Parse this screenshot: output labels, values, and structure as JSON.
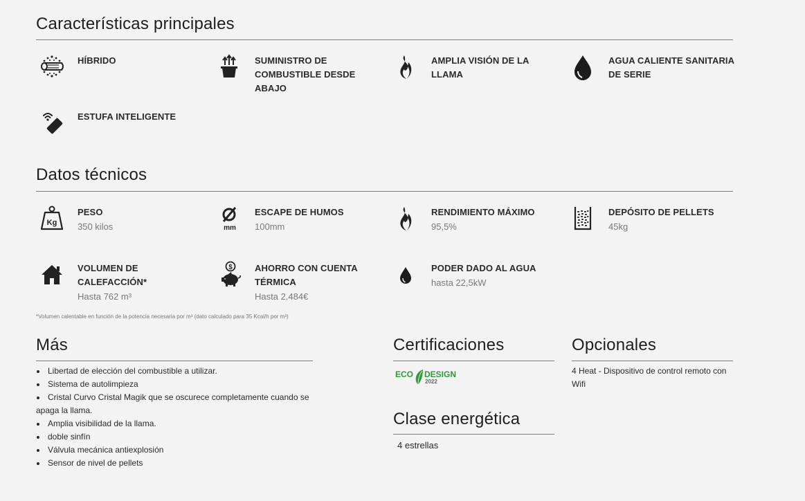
{
  "caracteristicas": {
    "title": "Características principales",
    "items": [
      {
        "label": "HÍBRIDO",
        "icon": "hybrid-log-pellet-icon"
      },
      {
        "label": "SUMINISTRO DE COMBUSTIBLE DESDE ABAJO",
        "icon": "bottom-feed-icon"
      },
      {
        "label": "AMPLIA VISIÓN DE LA LLAMA",
        "icon": "flame-icon"
      },
      {
        "label": "AGUA CALIENTE SANITARIA DE SERIE",
        "icon": "water-drop-icon"
      },
      {
        "label": "ESTUFA INTELIGENTE",
        "icon": "smartphone-wifi-icon"
      }
    ]
  },
  "datos": {
    "title": "Datos técnicos",
    "items": [
      {
        "label": "PESO",
        "value": "350 kilos",
        "icon": "kg-weight-icon"
      },
      {
        "label": "ESCAPE DE HUMOS",
        "value": "100mm",
        "icon": "diameter-mm-icon"
      },
      {
        "label": "RENDIMIENTO MÁXIMO",
        "value": "95,5%",
        "icon": "flame-icon"
      },
      {
        "label": "DEPÓSITO DE PELLETS",
        "value": "45kg",
        "icon": "pellet-tank-icon"
      },
      {
        "label": "VOLUMEN DE CALEFACCIÓN*",
        "value": "Hasta 762 m³",
        "icon": "house-icon"
      },
      {
        "label": "AHORRO CON CUENTA TÉRMICA",
        "value": "Hasta 2.484€",
        "icon": "piggy-bank-icon"
      },
      {
        "label": "PODER DADO AL AGUA",
        "value": "hasta 22,5kW",
        "icon": "water-drop-icon"
      }
    ],
    "note": "*Volumen calentable en función de la potencia necesaria por m³ (dato calculado para 35 Kcal/h por m³)"
  },
  "mas": {
    "title": "Más",
    "items": [
      "Libertad de elección del combustible a utilizar.",
      "Sistema de autolimpieza",
      "Cristal Curvo Cristal Magik que se oscurece completamente cuando se apaga la llama.",
      "Amplia visibilidad de la llama.",
      "doble sinfín",
      "Válvula mecánica antiexplosión",
      "Sensor de nivel de pellets"
    ]
  },
  "certificaciones": {
    "title": "Certificaciones",
    "badge": {
      "line1a": "ECO",
      "line1b": "DESIGN",
      "year": "2022",
      "green": "#2e9a3a"
    }
  },
  "clase": {
    "title": "Clase energética",
    "value": "4 estrellas"
  },
  "opcionales": {
    "title": "Opcionales",
    "value": "4 Heat - Dispositivo de control remoto con Wifi"
  }
}
